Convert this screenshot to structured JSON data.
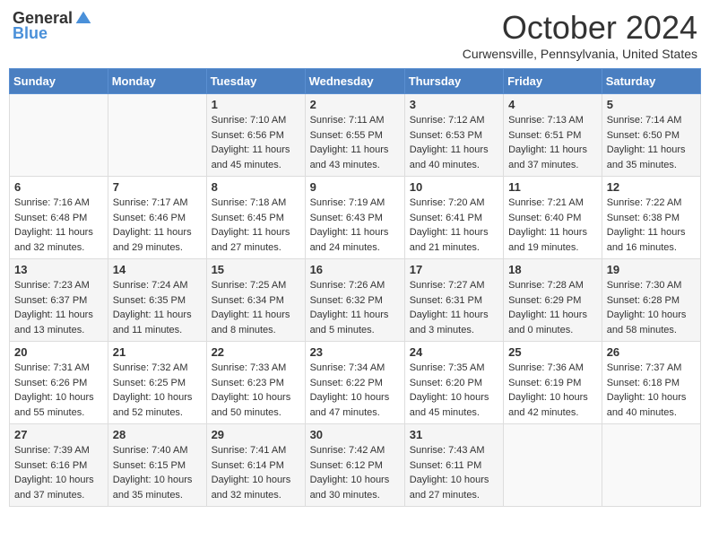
{
  "header": {
    "logo_general": "General",
    "logo_blue": "Blue",
    "month_title": "October 2024",
    "location": "Curwensville, Pennsylvania, United States"
  },
  "days_of_week": [
    "Sunday",
    "Monday",
    "Tuesday",
    "Wednesday",
    "Thursday",
    "Friday",
    "Saturday"
  ],
  "weeks": [
    [
      {
        "day": "",
        "sunrise": "",
        "sunset": "",
        "daylight": ""
      },
      {
        "day": "",
        "sunrise": "",
        "sunset": "",
        "daylight": ""
      },
      {
        "day": "1",
        "sunrise": "Sunrise: 7:10 AM",
        "sunset": "Sunset: 6:56 PM",
        "daylight": "Daylight: 11 hours and 45 minutes."
      },
      {
        "day": "2",
        "sunrise": "Sunrise: 7:11 AM",
        "sunset": "Sunset: 6:55 PM",
        "daylight": "Daylight: 11 hours and 43 minutes."
      },
      {
        "day": "3",
        "sunrise": "Sunrise: 7:12 AM",
        "sunset": "Sunset: 6:53 PM",
        "daylight": "Daylight: 11 hours and 40 minutes."
      },
      {
        "day": "4",
        "sunrise": "Sunrise: 7:13 AM",
        "sunset": "Sunset: 6:51 PM",
        "daylight": "Daylight: 11 hours and 37 minutes."
      },
      {
        "day": "5",
        "sunrise": "Sunrise: 7:14 AM",
        "sunset": "Sunset: 6:50 PM",
        "daylight": "Daylight: 11 hours and 35 minutes."
      }
    ],
    [
      {
        "day": "6",
        "sunrise": "Sunrise: 7:16 AM",
        "sunset": "Sunset: 6:48 PM",
        "daylight": "Daylight: 11 hours and 32 minutes."
      },
      {
        "day": "7",
        "sunrise": "Sunrise: 7:17 AM",
        "sunset": "Sunset: 6:46 PM",
        "daylight": "Daylight: 11 hours and 29 minutes."
      },
      {
        "day": "8",
        "sunrise": "Sunrise: 7:18 AM",
        "sunset": "Sunset: 6:45 PM",
        "daylight": "Daylight: 11 hours and 27 minutes."
      },
      {
        "day": "9",
        "sunrise": "Sunrise: 7:19 AM",
        "sunset": "Sunset: 6:43 PM",
        "daylight": "Daylight: 11 hours and 24 minutes."
      },
      {
        "day": "10",
        "sunrise": "Sunrise: 7:20 AM",
        "sunset": "Sunset: 6:41 PM",
        "daylight": "Daylight: 11 hours and 21 minutes."
      },
      {
        "day": "11",
        "sunrise": "Sunrise: 7:21 AM",
        "sunset": "Sunset: 6:40 PM",
        "daylight": "Daylight: 11 hours and 19 minutes."
      },
      {
        "day": "12",
        "sunrise": "Sunrise: 7:22 AM",
        "sunset": "Sunset: 6:38 PM",
        "daylight": "Daylight: 11 hours and 16 minutes."
      }
    ],
    [
      {
        "day": "13",
        "sunrise": "Sunrise: 7:23 AM",
        "sunset": "Sunset: 6:37 PM",
        "daylight": "Daylight: 11 hours and 13 minutes."
      },
      {
        "day": "14",
        "sunrise": "Sunrise: 7:24 AM",
        "sunset": "Sunset: 6:35 PM",
        "daylight": "Daylight: 11 hours and 11 minutes."
      },
      {
        "day": "15",
        "sunrise": "Sunrise: 7:25 AM",
        "sunset": "Sunset: 6:34 PM",
        "daylight": "Daylight: 11 hours and 8 minutes."
      },
      {
        "day": "16",
        "sunrise": "Sunrise: 7:26 AM",
        "sunset": "Sunset: 6:32 PM",
        "daylight": "Daylight: 11 hours and 5 minutes."
      },
      {
        "day": "17",
        "sunrise": "Sunrise: 7:27 AM",
        "sunset": "Sunset: 6:31 PM",
        "daylight": "Daylight: 11 hours and 3 minutes."
      },
      {
        "day": "18",
        "sunrise": "Sunrise: 7:28 AM",
        "sunset": "Sunset: 6:29 PM",
        "daylight": "Daylight: 11 hours and 0 minutes."
      },
      {
        "day": "19",
        "sunrise": "Sunrise: 7:30 AM",
        "sunset": "Sunset: 6:28 PM",
        "daylight": "Daylight: 10 hours and 58 minutes."
      }
    ],
    [
      {
        "day": "20",
        "sunrise": "Sunrise: 7:31 AM",
        "sunset": "Sunset: 6:26 PM",
        "daylight": "Daylight: 10 hours and 55 minutes."
      },
      {
        "day": "21",
        "sunrise": "Sunrise: 7:32 AM",
        "sunset": "Sunset: 6:25 PM",
        "daylight": "Daylight: 10 hours and 52 minutes."
      },
      {
        "day": "22",
        "sunrise": "Sunrise: 7:33 AM",
        "sunset": "Sunset: 6:23 PM",
        "daylight": "Daylight: 10 hours and 50 minutes."
      },
      {
        "day": "23",
        "sunrise": "Sunrise: 7:34 AM",
        "sunset": "Sunset: 6:22 PM",
        "daylight": "Daylight: 10 hours and 47 minutes."
      },
      {
        "day": "24",
        "sunrise": "Sunrise: 7:35 AM",
        "sunset": "Sunset: 6:20 PM",
        "daylight": "Daylight: 10 hours and 45 minutes."
      },
      {
        "day": "25",
        "sunrise": "Sunrise: 7:36 AM",
        "sunset": "Sunset: 6:19 PM",
        "daylight": "Daylight: 10 hours and 42 minutes."
      },
      {
        "day": "26",
        "sunrise": "Sunrise: 7:37 AM",
        "sunset": "Sunset: 6:18 PM",
        "daylight": "Daylight: 10 hours and 40 minutes."
      }
    ],
    [
      {
        "day": "27",
        "sunrise": "Sunrise: 7:39 AM",
        "sunset": "Sunset: 6:16 PM",
        "daylight": "Daylight: 10 hours and 37 minutes."
      },
      {
        "day": "28",
        "sunrise": "Sunrise: 7:40 AM",
        "sunset": "Sunset: 6:15 PM",
        "daylight": "Daylight: 10 hours and 35 minutes."
      },
      {
        "day": "29",
        "sunrise": "Sunrise: 7:41 AM",
        "sunset": "Sunset: 6:14 PM",
        "daylight": "Daylight: 10 hours and 32 minutes."
      },
      {
        "day": "30",
        "sunrise": "Sunrise: 7:42 AM",
        "sunset": "Sunset: 6:12 PM",
        "daylight": "Daylight: 10 hours and 30 minutes."
      },
      {
        "day": "31",
        "sunrise": "Sunrise: 7:43 AM",
        "sunset": "Sunset: 6:11 PM",
        "daylight": "Daylight: 10 hours and 27 minutes."
      },
      {
        "day": "",
        "sunrise": "",
        "sunset": "",
        "daylight": ""
      },
      {
        "day": "",
        "sunrise": "",
        "sunset": "",
        "daylight": ""
      }
    ]
  ]
}
